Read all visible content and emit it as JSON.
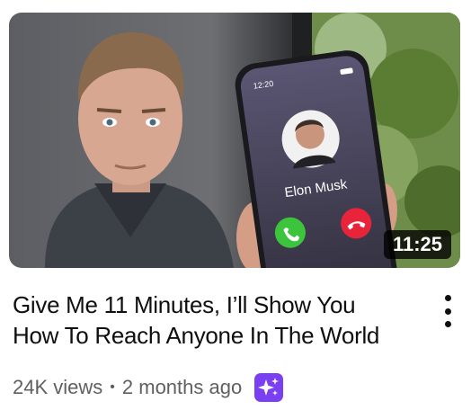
{
  "video": {
    "title_line1": "Give Me 11 Minutes, I’ll Show You",
    "title_line2": "How To Reach Anyone In The World",
    "duration": "11:25",
    "views": "24K views",
    "separator": "•",
    "age": "2 months ago"
  },
  "thumbnail": {
    "phone_time": "12:20",
    "caller_name": "Elon Musk"
  },
  "icons": {
    "more": "vertical-dots-icon",
    "ai_badge": "sparkle-icon",
    "accept_call": "phone-accept-icon",
    "decline_call": "phone-decline-icon"
  },
  "colors": {
    "badge": "#7b3ff2",
    "accept": "#3cc43c",
    "decline": "#e8243a",
    "title": "#0f0f0f",
    "meta": "#606060"
  }
}
